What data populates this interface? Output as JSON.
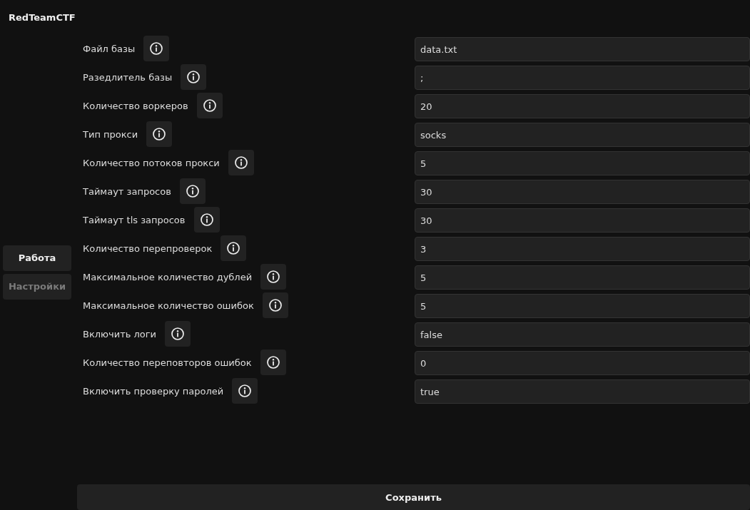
{
  "app": {
    "title": "RedTeamCTF"
  },
  "nav": [
    {
      "label": "Работа",
      "selected": true
    },
    {
      "label": "Настройки",
      "selected": false
    }
  ],
  "settings": [
    {
      "label": "Файл базы",
      "value": "data.txt"
    },
    {
      "label": "Разедлитель базы",
      "value": ";"
    },
    {
      "label": "Количество воркеров",
      "value": "20"
    },
    {
      "label": "Тип прокси",
      "value": "socks"
    },
    {
      "label": "Количество потоков прокси",
      "value": "5"
    },
    {
      "label": "Таймаут запросов",
      "value": "30"
    },
    {
      "label": "Таймаут tls запросов",
      "value": "30"
    },
    {
      "label": "Количество перепроверок",
      "value": "3"
    },
    {
      "label": "Максимальное количество дублей",
      "value": "5"
    },
    {
      "label": "Максимальное количество ошибок",
      "value": "5"
    },
    {
      "label": "Включить логи",
      "value": "false"
    },
    {
      "label": "Количество переповторов ошибок",
      "value": "0"
    },
    {
      "label": "Включить проверку паролей",
      "value": "true"
    }
  ],
  "save_button": {
    "label": "Сохранить"
  }
}
